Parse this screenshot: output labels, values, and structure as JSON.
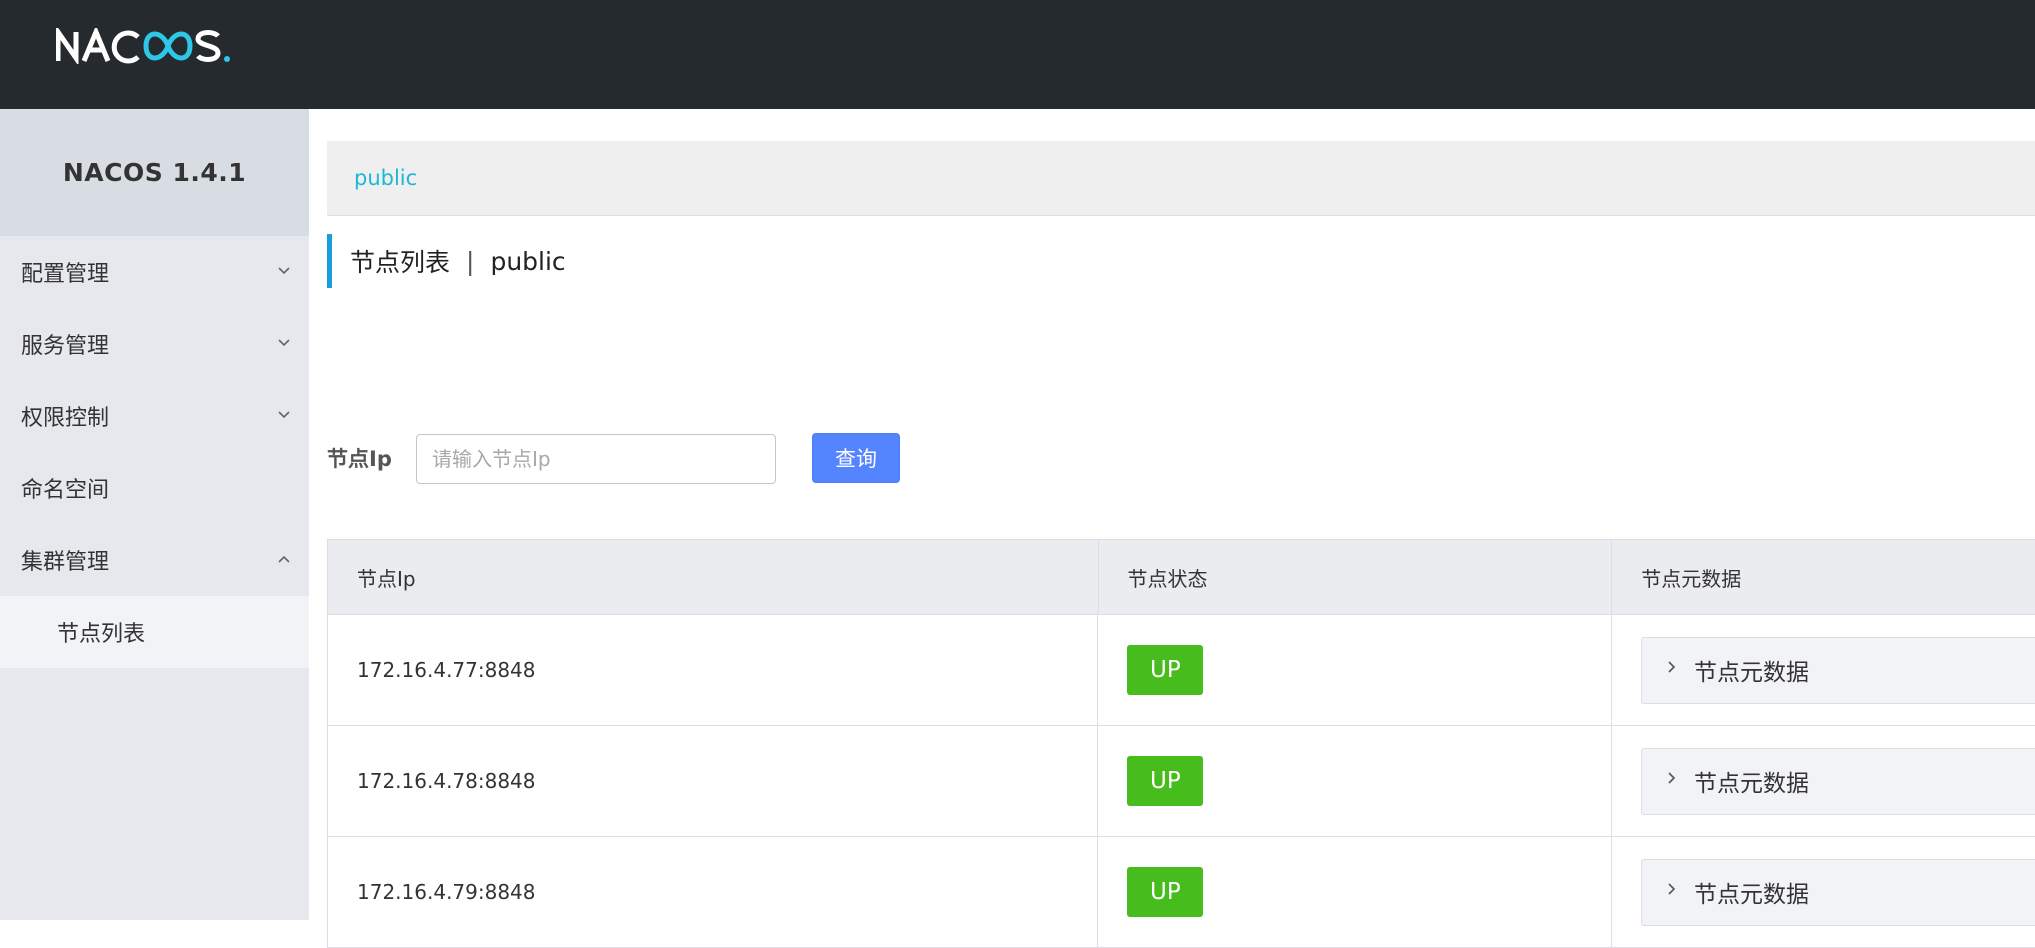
{
  "header": {
    "logo_text": "NACOS."
  },
  "sidebar": {
    "title": "NACOS 1.4.1",
    "items": [
      {
        "label": "配置管理",
        "icon": "chevron-down-icon"
      },
      {
        "label": "服务管理",
        "icon": "chevron-down-icon"
      },
      {
        "label": "权限控制",
        "icon": "chevron-down-icon"
      },
      {
        "label": "命名空间"
      },
      {
        "label": "集群管理",
        "icon": "chevron-up-icon"
      }
    ],
    "subitems": [
      {
        "label": "节点列表"
      }
    ]
  },
  "namespace_bar": {
    "current": "public"
  },
  "page": {
    "title": "节点列表",
    "separator": "|",
    "namespace": "public"
  },
  "search": {
    "label": "节点Ip",
    "placeholder": "请输入节点Ip",
    "value": "",
    "button_label": "查询"
  },
  "table": {
    "columns": [
      "节点Ip",
      "节点状态",
      "节点元数据"
    ],
    "rows": [
      {
        "ip": "172.16.4.77:8848",
        "status": "UP",
        "meta": "节点元数据"
      },
      {
        "ip": "172.16.4.78:8848",
        "status": "UP",
        "meta": "节点元数据"
      },
      {
        "ip": "172.16.4.79:8848",
        "status": "UP",
        "meta": "节点元数据"
      }
    ]
  },
  "colors": {
    "topbar": "#252a2f",
    "accent": "#1cb8d8",
    "primary_button": "#5584ff",
    "status_up": "#46bd1c"
  }
}
